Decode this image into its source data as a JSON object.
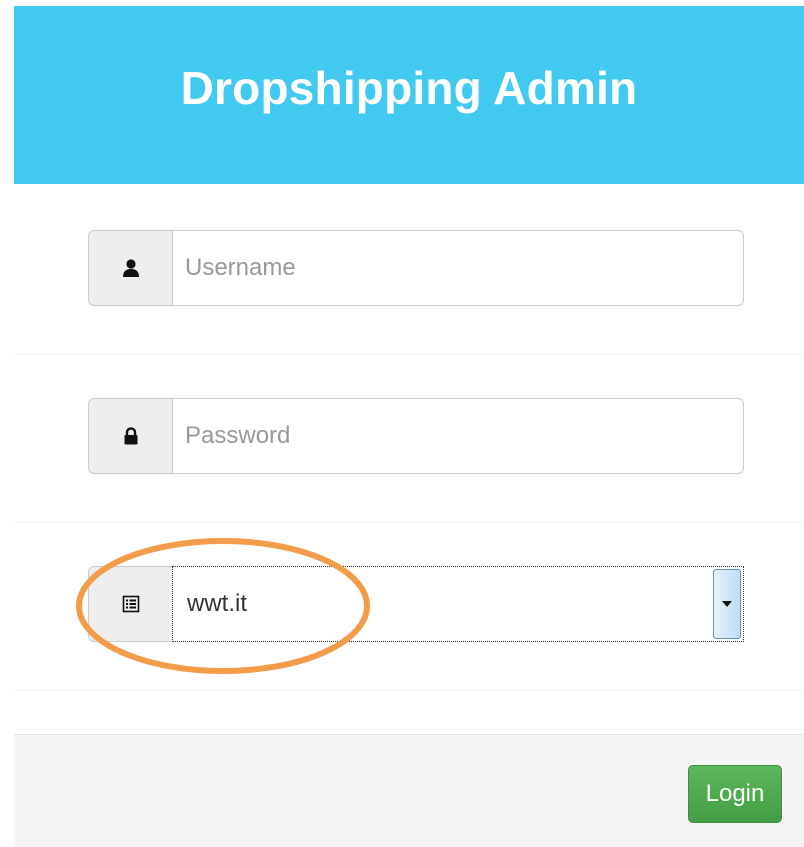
{
  "header": {
    "title": "Dropshipping Admin"
  },
  "form": {
    "username": {
      "icon": "user-icon",
      "placeholder": "Username",
      "value": ""
    },
    "password": {
      "icon": "lock-icon",
      "placeholder": "Password",
      "value": ""
    },
    "store_select": {
      "icon": "list-icon",
      "selected": "wwt.it"
    }
  },
  "footer": {
    "login_label": "Login"
  },
  "annotation": {
    "ellipse_color": "#f39c4a"
  },
  "colors": {
    "header_bg": "#41c9ef",
    "login_button": "#5cb85c"
  }
}
